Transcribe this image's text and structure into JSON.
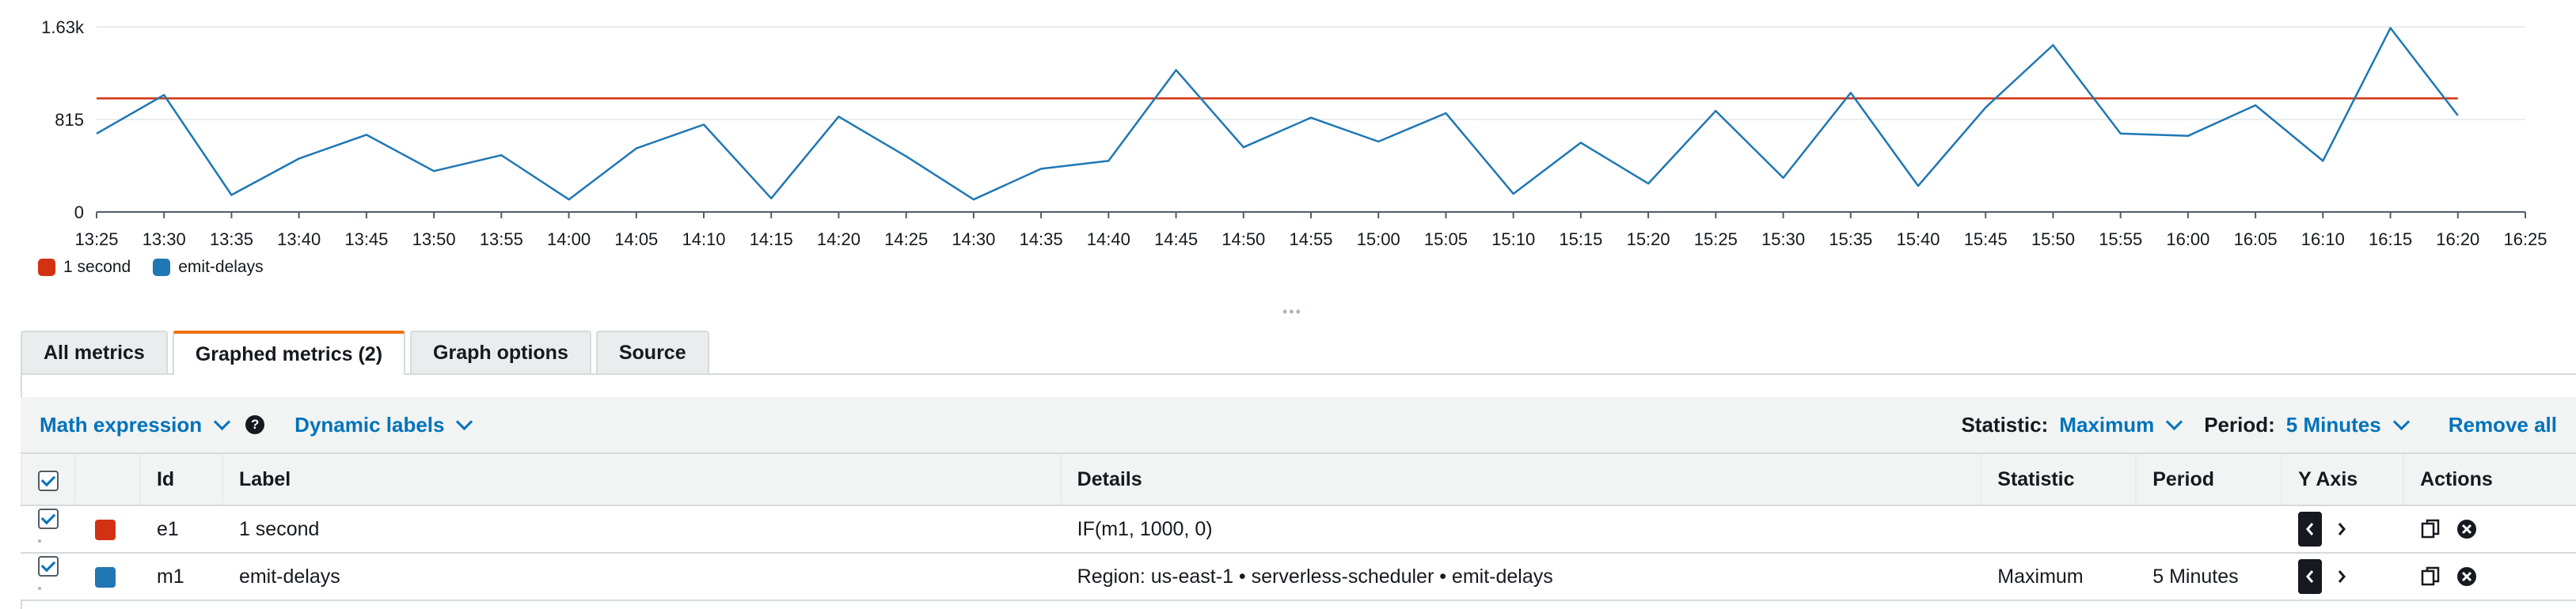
{
  "chart_data": {
    "type": "line",
    "ylim": [
      0,
      1630
    ],
    "y_ticks": [
      "0",
      "815",
      "1.63k"
    ],
    "x_ticks": [
      "13:25",
      "13:30",
      "13:35",
      "13:40",
      "13:45",
      "13:50",
      "13:55",
      "14:00",
      "14:05",
      "14:10",
      "14:15",
      "14:20",
      "14:25",
      "14:30",
      "14:35",
      "14:40",
      "14:45",
      "14:50",
      "14:55",
      "15:00",
      "15:05",
      "15:10",
      "15:15",
      "15:20",
      "15:25",
      "15:30",
      "15:35",
      "15:40",
      "15:45",
      "15:50",
      "15:55",
      "16:00",
      "16:05",
      "16:10",
      "16:15",
      "16:20",
      "16:25"
    ],
    "legend_position": "bottom-left",
    "grid": true,
    "series": [
      {
        "name": "1 second",
        "color": "#d13212",
        "x": [
          "13:25",
          "14:00",
          "14:30",
          "15:00",
          "15:30",
          "16:00",
          "16:20"
        ],
        "values": [
          1000,
          1000,
          1000,
          1000,
          1000,
          1000,
          1000
        ]
      },
      {
        "name": "emit-delays",
        "color": "#1f77b4",
        "x": [
          "13:25",
          "13:30",
          "13:35",
          "13:40",
          "13:45",
          "13:50",
          "13:55",
          "14:00",
          "14:05",
          "14:10",
          "14:15",
          "14:20",
          "14:25",
          "14:30",
          "14:35",
          "14:40",
          "14:45",
          "14:50",
          "14:55",
          "15:00",
          "15:05",
          "15:10",
          "15:15",
          "15:20",
          "15:25",
          "15:30",
          "15:35",
          "15:40",
          "15:45",
          "15:50",
          "15:55",
          "16:00",
          "16:05",
          "16:10",
          "16:15",
          "16:20"
        ],
        "values": [
          690,
          1030,
          150,
          470,
          680,
          360,
          500,
          110,
          560,
          770,
          120,
          840,
          490,
          110,
          380,
          450,
          1250,
          570,
          830,
          620,
          870,
          160,
          610,
          250,
          890,
          300,
          1050,
          230,
          920,
          1470,
          690,
          670,
          940,
          450,
          1620,
          850
        ]
      }
    ]
  },
  "legend": [
    {
      "label": "1 second",
      "color": "#d13212"
    },
    {
      "label": "emit-delays",
      "color": "#1f77b4"
    }
  ],
  "tabs": [
    {
      "label": "All metrics"
    },
    {
      "label": "Graphed metrics (2)"
    },
    {
      "label": "Graph options"
    },
    {
      "label": "Source"
    }
  ],
  "toolbar": {
    "math_expression": "Math expression",
    "dynamic_labels": "Dynamic labels",
    "statistic_label": "Statistic:",
    "statistic_value": "Maximum",
    "period_label": "Period:",
    "period_value": "5 Minutes",
    "remove_all": "Remove all"
  },
  "table": {
    "headers": {
      "id": "Id",
      "label": "Label",
      "details": "Details",
      "statistic": "Statistic",
      "period": "Period",
      "yaxis": "Y Axis",
      "actions": "Actions"
    },
    "rows": [
      {
        "id": "e1",
        "color": "#d13212",
        "label": "1 second",
        "details": "IF(m1, 1000, 0)",
        "statistic": "",
        "period": ""
      },
      {
        "id": "m1",
        "color": "#1f77b4",
        "label": "emit-delays",
        "details": "Region: us-east-1 • serverless-scheduler • emit-delays",
        "statistic": "Maximum",
        "period": "5 Minutes"
      }
    ]
  }
}
